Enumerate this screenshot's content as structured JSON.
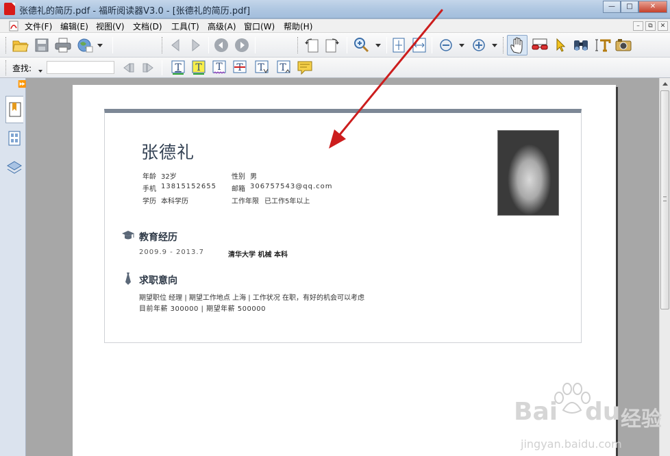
{
  "window": {
    "title": "张德礼的简历.pdf - 福昕阅读器V3.0 - [张德礼的简历.pdf]"
  },
  "menu": [
    "文件(F)",
    "编辑(E)",
    "视图(V)",
    "文档(D)",
    "工具(T)",
    "高级(A)",
    "窗口(W)",
    "帮助(H)"
  ],
  "find": {
    "label": "查找:",
    "placeholder": ""
  },
  "resume": {
    "name": "张德礼",
    "age_label": "年龄",
    "age": "32岁",
    "gender_label": "性别",
    "gender": "男",
    "phone_label": "手机",
    "phone": "13815152655",
    "email_label": "邮箱",
    "email": "306757543@qq.com",
    "edu_label": "学历",
    "edu": "本科学历",
    "work_years_label": "工作年限",
    "work_years": "已工作5年以上",
    "education": {
      "title": "教育经历",
      "period": "2009.9 - 2013.7",
      "detail": "清华大学  机械  本科"
    },
    "intent": {
      "title": "求职意向",
      "line1": "期望职位 经理 | 期望工作地点 上海 | 工作状况 在职，有好的机会可以考虑",
      "line2": "目前年薪 300000 | 期望年薪 500000"
    }
  },
  "watermark": {
    "brand": "Bai",
    "brand_cn": "经验",
    "url": "jingyan.baidu.com"
  },
  "colors": {
    "arrow": "#cc1d1d",
    "titlebar": "#b8cde5",
    "page_bg": "#a7a7a7"
  }
}
